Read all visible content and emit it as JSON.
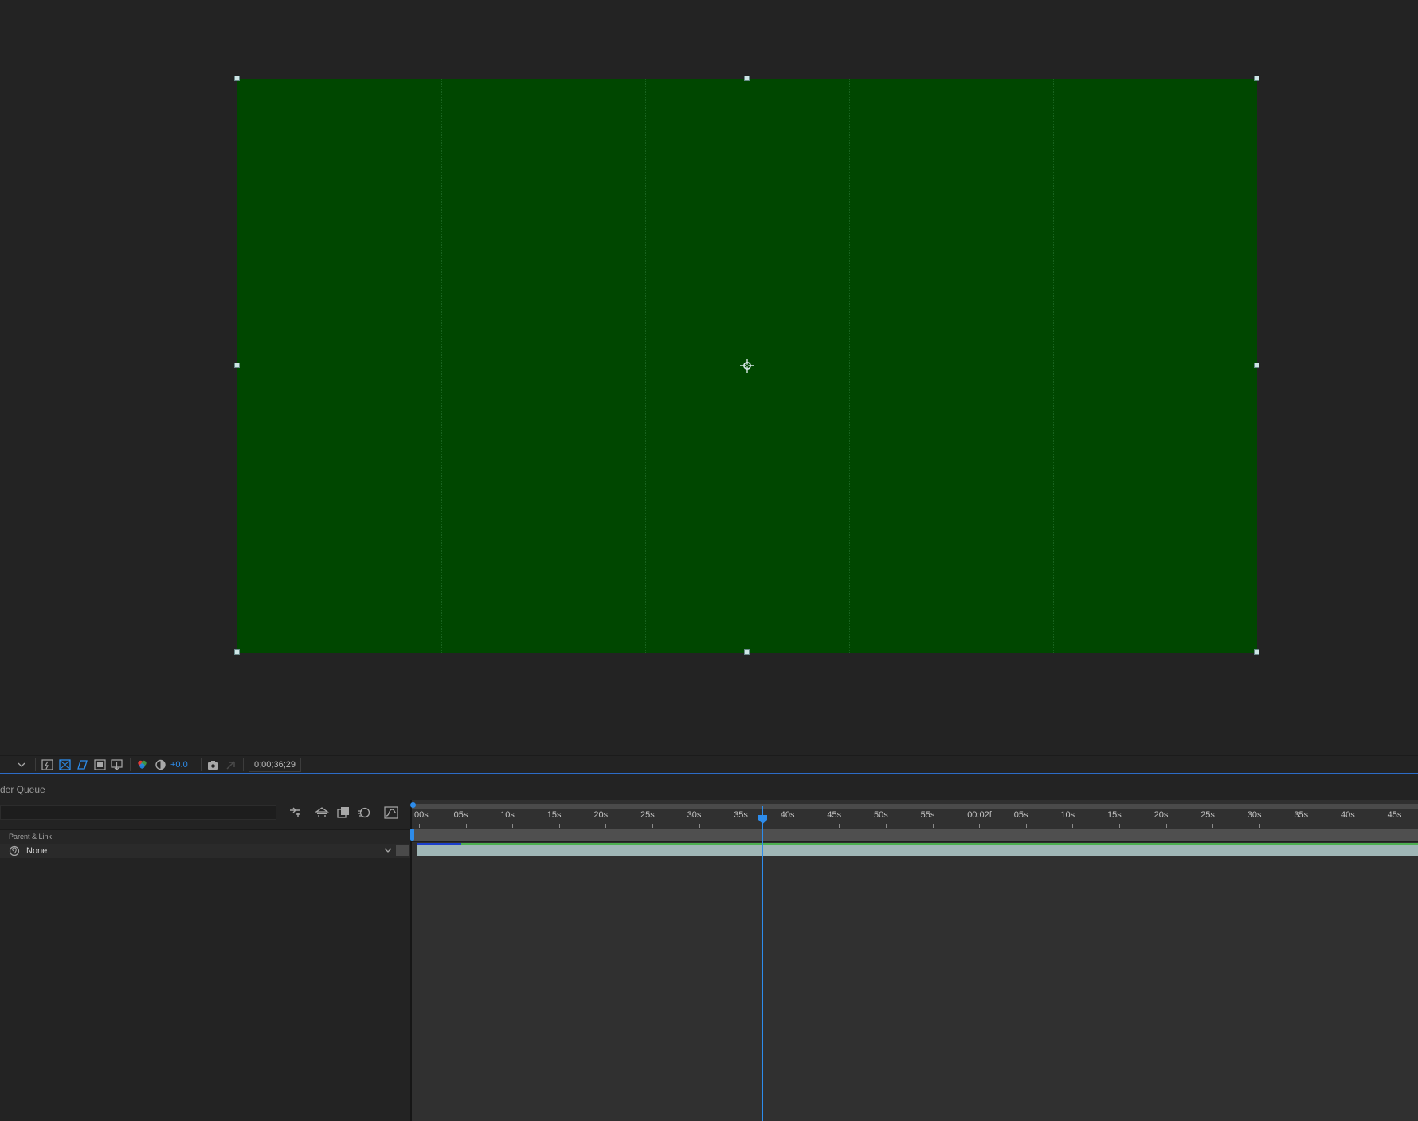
{
  "viewer": {
    "composition_color": "#004700",
    "icons": [
      "fast-preview-icon",
      "transparency-grid-icon",
      "mask-visibility-icon",
      "region-of-interest-icon",
      "toggle-3d-view-icon",
      "show-channel-icon",
      "reset-exposure-icon",
      "snapshot-icon",
      "show-snapshot-icon"
    ],
    "exposure_value": "+0.0",
    "current_time": "0;00;36;29"
  },
  "panels": {
    "tab_label": "der Queue"
  },
  "timeline": {
    "search_placeholder": "",
    "column_header": "Parent & Link",
    "layer_parent_value": "None",
    "ruler_labels": [
      ":00s",
      "05s",
      "10s",
      "15s",
      "20s",
      "25s",
      "30s",
      "35s",
      "40s",
      "45s",
      "50s",
      "55s",
      "00:02f",
      "05s",
      "10s",
      "15s",
      "20s",
      "25s",
      "30s",
      "35s",
      "40s",
      "45s"
    ],
    "playhead_label": "0;00;36;29",
    "colors": {
      "accent": "#2d8ceb",
      "layer_bar": "#9fb6b6",
      "layer_bar_top": "#4caf50"
    }
  }
}
